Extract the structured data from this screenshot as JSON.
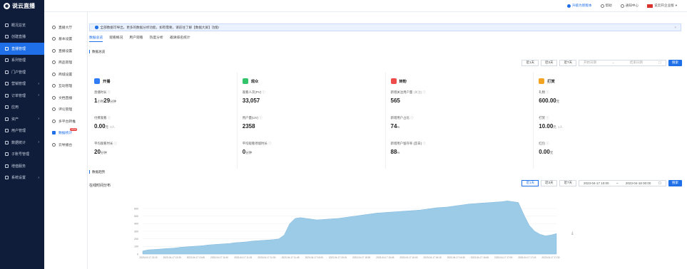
{
  "app": {
    "logo": "说云直播"
  },
  "sidebar": {
    "items": [
      {
        "label": "概况总览",
        "arrow": false,
        "active": false
      },
      {
        "label": "创建直播",
        "arrow": false,
        "active": false
      },
      {
        "label": "直播管理",
        "arrow": false,
        "active": true
      },
      {
        "label": "系列管理",
        "arrow": false,
        "active": false
      },
      {
        "label": "门户管理",
        "arrow": false,
        "active": false
      },
      {
        "label": "营销管理",
        "arrow": true,
        "active": false
      },
      {
        "label": "订单管理",
        "arrow": true,
        "active": false
      },
      {
        "label": "应用",
        "arrow": false,
        "active": false
      },
      {
        "label": "资产",
        "arrow": true,
        "active": false
      },
      {
        "label": "用户管理",
        "arrow": false,
        "active": false
      },
      {
        "label": "数据统计",
        "arrow": true,
        "active": false
      },
      {
        "label": "子账号管理",
        "arrow": false,
        "active": false
      },
      {
        "label": "增值服务",
        "arrow": false,
        "active": false
      },
      {
        "label": "系统设置",
        "arrow": true,
        "active": false
      }
    ]
  },
  "topbar": {
    "new_feature": "升级为新版本",
    "help": "帮助",
    "notify": "通知中心",
    "user": "说云开企业版"
  },
  "subnav": {
    "items": [
      {
        "label": "直播大厅",
        "active": false,
        "badge": ""
      },
      {
        "label": "基本设置",
        "active": false,
        "badge": ""
      },
      {
        "label": "直播设置",
        "active": false,
        "badge": ""
      },
      {
        "label": "商品管理",
        "active": false,
        "badge": ""
      },
      {
        "label": "商城设置",
        "active": false,
        "badge": ""
      },
      {
        "label": "互动管理",
        "active": false,
        "badge": ""
      },
      {
        "label": "文档直播",
        "active": false,
        "badge": ""
      },
      {
        "label": "评论管理",
        "active": false,
        "badge": ""
      },
      {
        "label": "多平台转推",
        "active": false,
        "badge": ""
      },
      {
        "label": "数据统计",
        "active": true,
        "badge": "NEW"
      },
      {
        "label": "云导播台",
        "active": false,
        "badge": ""
      }
    ]
  },
  "notice": {
    "text": "全部数据可导出，更多的数据分析功能，如有需要，请前往了解【数据大屏】功能!"
  },
  "tabs": [
    "数据总览",
    "观看概况",
    "用户观看",
    "热度分析",
    "邀请排名统计"
  ],
  "overview": {
    "section_title": "数据总览",
    "ranges": [
      "近1天",
      "近3天",
      "近7天"
    ],
    "start_placeholder": "开始日期",
    "end_placeholder": "结束日期",
    "separator": "~",
    "search": "搜索"
  },
  "cards": [
    {
      "title": "开播",
      "color": "#2f7cf6",
      "metrics": [
        {
          "label": "直播时长",
          "tag": "",
          "value": "1",
          "unit": "小时",
          "value2": "29",
          "unit2": "分钟"
        },
        {
          "label": "付费观看",
          "tag": "",
          "value": "0.00",
          "unit": "元",
          "value2": "",
          "unit2": "0人"
        },
        {
          "label": "平均观看时长",
          "tag": "",
          "value": "20",
          "unit": "分钟",
          "value2": "",
          "unit2": ""
        }
      ]
    },
    {
      "title": "观众",
      "color": "#31c46b",
      "metrics": [
        {
          "label": "观看人次(PV)",
          "tag": "",
          "value": "33,057",
          "unit": "",
          "value2": "",
          "unit2": ""
        },
        {
          "label": "用户量(UV)",
          "tag": "",
          "value": "2358",
          "unit": "",
          "value2": "",
          "unit2": ""
        },
        {
          "label": "平均观看停留时长",
          "tag": "",
          "value": "0",
          "unit": "分钟",
          "value2": "",
          "unit2": ""
        }
      ]
    },
    {
      "title": "转粉",
      "color": "#ef4b4b",
      "metrics": [
        {
          "label": "新增关注用户量",
          "tag": "(关注)",
          "value": "565",
          "unit": "",
          "value2": "",
          "unit2": ""
        },
        {
          "label": "新增用户占比",
          "tag": "",
          "value": "74",
          "unit": "%",
          "value2": "",
          "unit2": ""
        },
        {
          "label": "新增用户留存率 (首日)",
          "tag": "",
          "value": "88",
          "unit": "%",
          "value2": "",
          "unit2": ""
        }
      ]
    },
    {
      "title": "打赏",
      "color": "#f3a423",
      "metrics": [
        {
          "label": "礼物",
          "tag": "",
          "value": "600.00",
          "unit": "元",
          "value2": "",
          "unit2": ""
        },
        {
          "label": "打赏",
          "tag": "",
          "value": "10.00",
          "unit": "元",
          "value2": "",
          "unit2": "1人"
        },
        {
          "label": "红包",
          "tag": "",
          "value": "0.00",
          "unit": "元",
          "value2": "",
          "unit2": ""
        }
      ]
    }
  ],
  "details": {
    "section_title": "数据趋势",
    "chart_title": "在线时间分布",
    "ranges": [
      "近1天",
      "近3天",
      "近7天"
    ],
    "active_range": 0,
    "start": "2023-04-17 10:00",
    "end": "2023-04-18 00:00",
    "separator": "~",
    "search": "搜索"
  },
  "chart_data": {
    "type": "area",
    "title": "",
    "xlabel": "",
    "ylabel": "",
    "ylim": [
      0,
      600
    ],
    "y_ticks": [
      0,
      100,
      200,
      300,
      400,
      500,
      600
    ],
    "x_ticks": [
      "2023-04-17 13:15",
      "2023-04-17 13:30",
      "2023-04-17 13:45",
      "2023-04-17 11:00",
      "2023-04-17 11:15",
      "2023-04-17 11:30",
      "2023-04-17 11:45",
      "2023-04-17 15:00",
      "2023-04-17 15:15",
      "2023-04-17 15:30",
      "2023-04-17 15:45",
      "2023-04-17 16:00",
      "2023-04-17 16:15",
      "2023-04-17 16:30",
      "2023-04-17 16:45",
      "2023-04-17 17:00",
      "2023-04-17 17:15",
      "2023-04-17 17:30"
    ],
    "color": "#9ccbe8",
    "values": [
      40,
      55,
      60,
      65,
      70,
      75,
      80,
      90,
      95,
      100,
      105,
      110,
      120,
      125,
      130,
      135,
      140,
      150,
      155,
      160,
      170,
      175,
      180,
      185,
      190,
      200,
      250,
      400,
      470,
      480,
      470,
      460,
      450,
      455,
      460,
      465,
      470,
      480,
      490,
      500,
      510,
      520,
      530,
      540,
      545,
      550,
      555,
      560,
      565,
      570,
      575,
      580,
      590,
      600,
      610,
      615,
      620,
      630,
      640,
      650,
      660,
      665,
      670,
      675,
      680,
      685,
      690,
      700,
      690,
      680,
      520,
      380,
      300,
      260,
      240,
      250,
      270
    ]
  }
}
